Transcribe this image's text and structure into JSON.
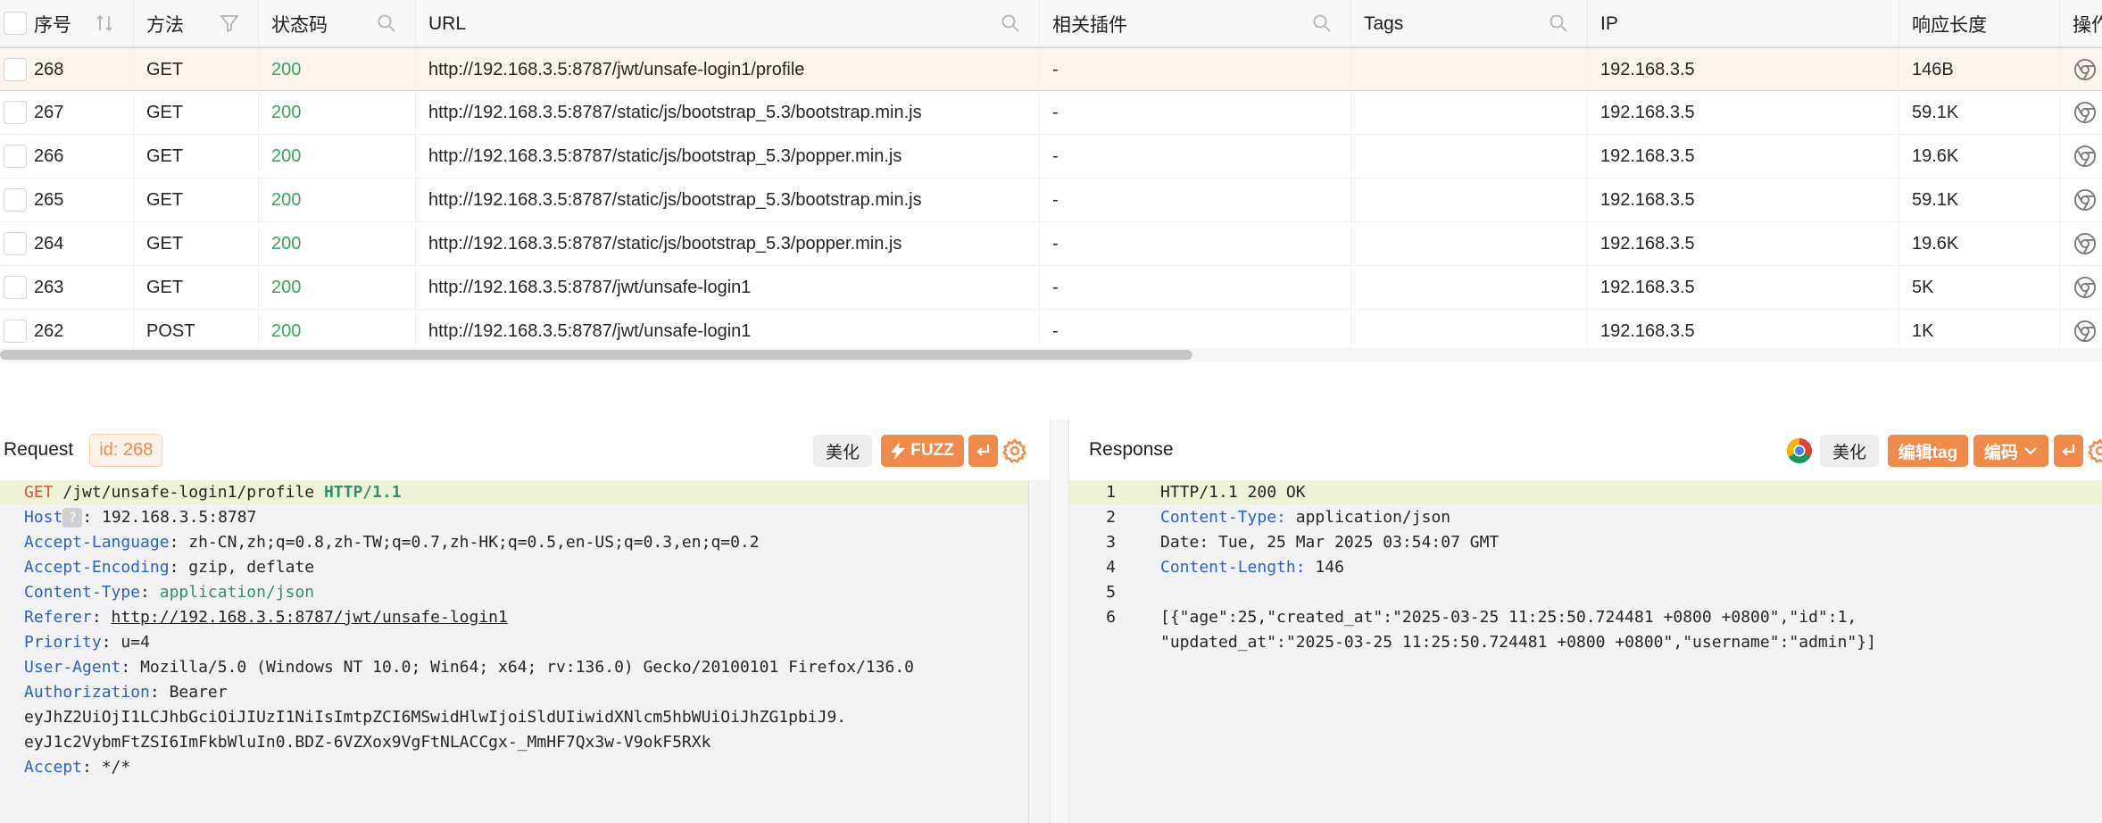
{
  "columns": [
    {
      "label": "序号",
      "icon": "sort-icon"
    },
    {
      "label": "方法",
      "icon": "filter-icon"
    },
    {
      "label": "状态码",
      "icon": "search-icon"
    },
    {
      "label": "URL",
      "icon": "search-icon"
    },
    {
      "label": "相关插件",
      "icon": "search-icon"
    },
    {
      "label": "Tags",
      "icon": "search-icon"
    },
    {
      "label": "IP",
      "icon": ""
    },
    {
      "label": "响应长度",
      "icon": ""
    },
    {
      "label": "操作",
      "icon": ""
    }
  ],
  "rows": [
    {
      "id": "268",
      "method": "GET",
      "status": "200",
      "url": "http://192.168.3.5:8787/jwt/unsafe-login1/profile",
      "plugin": "-",
      "tags": "",
      "ip": "192.168.3.5",
      "length": "146B",
      "selected": true
    },
    {
      "id": "267",
      "method": "GET",
      "status": "200",
      "url": "http://192.168.3.5:8787/static/js/bootstrap_5.3/bootstrap.min.js",
      "plugin": "-",
      "tags": "",
      "ip": "192.168.3.5",
      "length": "59.1K",
      "selected": false
    },
    {
      "id": "266",
      "method": "GET",
      "status": "200",
      "url": "http://192.168.3.5:8787/static/js/bootstrap_5.3/popper.min.js",
      "plugin": "-",
      "tags": "",
      "ip": "192.168.3.5",
      "length": "19.6K",
      "selected": false
    },
    {
      "id": "265",
      "method": "GET",
      "status": "200",
      "url": "http://192.168.3.5:8787/static/js/bootstrap_5.3/bootstrap.min.js",
      "plugin": "-",
      "tags": "",
      "ip": "192.168.3.5",
      "length": "59.1K",
      "selected": false
    },
    {
      "id": "264",
      "method": "GET",
      "status": "200",
      "url": "http://192.168.3.5:8787/static/js/bootstrap_5.3/popper.min.js",
      "plugin": "-",
      "tags": "",
      "ip": "192.168.3.5",
      "length": "19.6K",
      "selected": false
    },
    {
      "id": "263",
      "method": "GET",
      "status": "200",
      "url": "http://192.168.3.5:8787/jwt/unsafe-login1",
      "plugin": "-",
      "tags": "",
      "ip": "192.168.3.5",
      "length": "5K",
      "selected": false
    },
    {
      "id": "262",
      "method": "POST",
      "status": "200",
      "url": "http://192.168.3.5:8787/jwt/unsafe-login1",
      "plugin": "-",
      "tags": "",
      "ip": "192.168.3.5",
      "length": "1K",
      "selected": false
    }
  ],
  "request": {
    "title": "Request",
    "id_tag": "id: 268",
    "beautify": "美化",
    "fuzz": "FUZZ",
    "line1": {
      "method": "GET",
      "path": " /jwt/unsafe-login1/profile ",
      "proto": "HTTP/1.1"
    },
    "headers": [
      {
        "key": "Host",
        "sep": ": ",
        "value": "192.168.3.5:8787",
        "qmark": "?"
      },
      {
        "key": "Accept-Language",
        "sep": ": ",
        "value": "zh-CN,zh;q=0.8,zh-TW;q=0.7,zh-HK;q=0.5,en-US;q=0.3,en;q=0.2"
      },
      {
        "key": "Accept-Encoding",
        "sep": ": ",
        "value": "gzip, deflate"
      },
      {
        "key": "Content-Type",
        "sep": ": ",
        "value": "application/json"
      },
      {
        "key": "Referer",
        "sep": ": ",
        "value": "http://192.168.3.5:8787/jwt/unsafe-login1"
      },
      {
        "key": "Priority",
        "sep": ": ",
        "value": "u=4"
      },
      {
        "key": "User-Agent",
        "sep": ": ",
        "value": "Mozilla/5.0 (Windows NT 10.0; Win64; x64; rv:136.0) Gecko/20100101 Firefox/136.0"
      },
      {
        "key": "Authorization",
        "sep": ": ",
        "value": "Bearer "
      }
    ],
    "token_line1": "eyJhZ2UiOjI1LCJhbGciOiJIUzI1NiIsImtpZCI6MSwidHlwIjoiSldUIiwidXNlcm5hbWUiOiJhZG1pbiJ9.",
    "token_line2": "eyJ1c2VybmFtZSI6ImFkbWluIn0.BDZ-6VZXox9VgFtNLACCgx-_MmHF7Qx3w-V9okF5RXk",
    "accept": {
      "key": "Accept",
      "sep": ": ",
      "value": "*/*"
    }
  },
  "response": {
    "title": "Response",
    "beautify": "美化",
    "edit_tag": "编辑tag",
    "encode": "编码",
    "lines": [
      {
        "n": "1",
        "key": "",
        "text": "HTTP/1.1 200 OK"
      },
      {
        "n": "2",
        "key": "Content-Type:",
        "text": " application/json"
      },
      {
        "n": "3",
        "key": "",
        "text": "Date: Tue, 25 Mar 2025 03:54:07 GMT"
      },
      {
        "n": "4",
        "key": "Content-Length:",
        "text": " 146"
      },
      {
        "n": "5",
        "key": "",
        "text": ""
      },
      {
        "n": "6",
        "key": "",
        "text": "[{\"age\":25,\"created_at\":\"2025-03-25 11:25:50.724481 +0800 +0800\",\"id\":1,"
      }
    ],
    "wrap_line": "\"updated_at\":\"2025-03-25 11:25:50.724481 +0800 +0800\",\"username\":\"admin\"}]"
  },
  "colors": {
    "accent": "#f08a4b",
    "status_ok": "#3aa55b",
    "header_key": "#2b62c4"
  }
}
